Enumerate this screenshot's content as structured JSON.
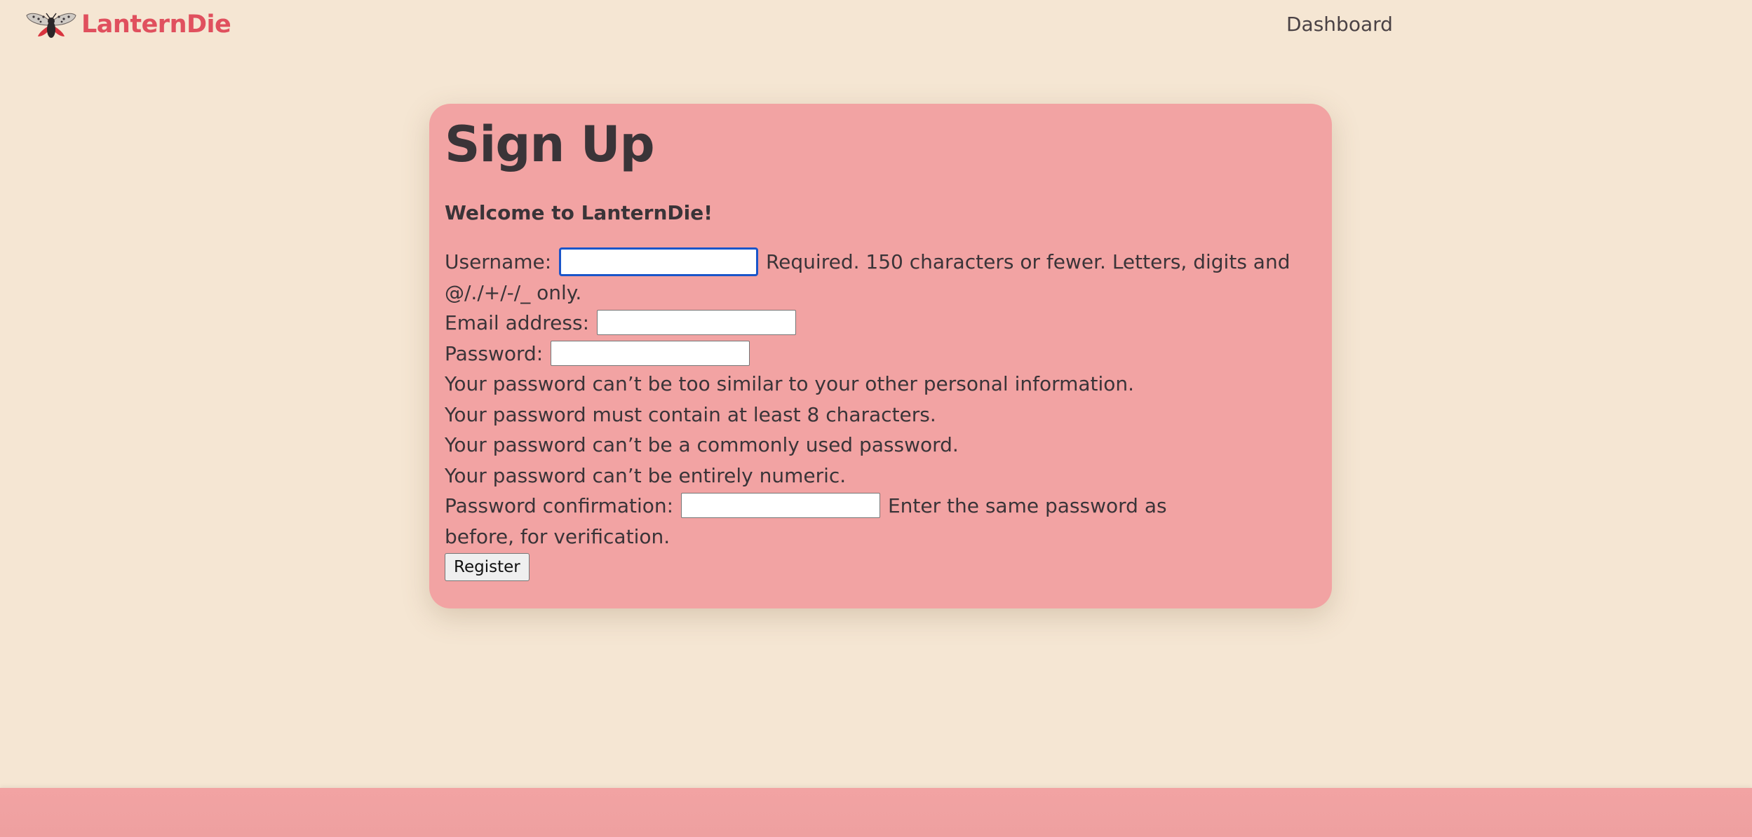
{
  "navbar": {
    "brand_name": "LanternDie",
    "logo_icon": "spotted-lanternfly-icon",
    "links": [
      {
        "label": "Dashboard"
      }
    ]
  },
  "signup": {
    "title": "Sign Up",
    "welcome": "Welcome to LanternDie!",
    "username": {
      "label": "Username:",
      "value": "",
      "help": "Required. 150 characters or fewer. Letters, digits and @/./+/-/_ only."
    },
    "email": {
      "label": "Email address:",
      "value": ""
    },
    "password": {
      "label": "Password:",
      "value": "",
      "rules": [
        "Your password can’t be too similar to your other personal information.",
        "Your password must contain at least 8 characters.",
        "Your password can’t be a commonly used password.",
        "Your password can’t be entirely numeric."
      ]
    },
    "password_confirm": {
      "label": "Password confirmation:",
      "value": "",
      "help": "Enter the same password as before, for verification."
    },
    "register_label": "Register"
  },
  "colors": {
    "page_background": "#f5e6d3",
    "card_background": "#f2a3a3",
    "brand_red": "#e0505e",
    "text": "#3a3438",
    "focus_ring": "#1a55c9"
  }
}
